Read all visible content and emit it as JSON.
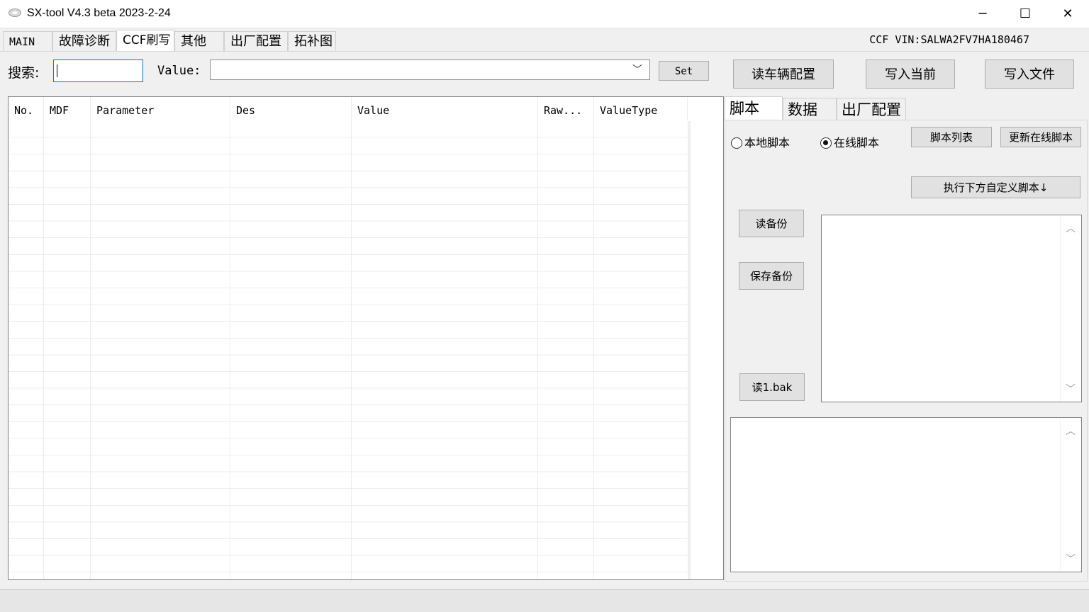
{
  "window": {
    "title": "SX-tool V4.3 beta 2023-2-24",
    "minimize_glyph": "─",
    "maximize_glyph": "☐",
    "close_glyph": "✕"
  },
  "tabs": [
    {
      "label": "MAIN"
    },
    {
      "label": "故障诊断"
    },
    {
      "label": "CCF刷写"
    },
    {
      "label": "其他"
    },
    {
      "label": "出厂配置"
    },
    {
      "label": "拓补图"
    }
  ],
  "active_tab": "CCF刷写",
  "vin_label": "CCF VIN:SALWA2FV7HA180467",
  "toolbar": {
    "search_label": "搜索:",
    "search_value": "",
    "value_label": "Value:",
    "value_selected": "",
    "set_label": "Set",
    "read_vehicle_label": "读车辆配置",
    "write_current_label": "写入当前",
    "write_file_label": "写入文件"
  },
  "grid": {
    "columns": [
      "No.",
      "MDF",
      "Parameter",
      "Des",
      "Value",
      "Raw...",
      "ValueType"
    ],
    "rows": []
  },
  "right_tabs": [
    {
      "label": "脚本"
    },
    {
      "label": "数据"
    },
    {
      "label": "出厂配置"
    }
  ],
  "script_panel": {
    "local_script_label": "本地脚本",
    "online_script_label": "在线脚本",
    "selected": "在线脚本",
    "script_list_label": "脚本列表",
    "update_online_label": "更新在线脚本",
    "run_custom_label": "执行下方自定义脚本↓",
    "read_backup_label": "读备份",
    "save_backup_label": "保存备份",
    "read_bak_label": "读1.bak",
    "script_text": "",
    "log_text": ""
  },
  "icons": {
    "app": "app-logo-icon",
    "dropdown": "chevron-down-icon",
    "scroll_up": "chevron-up-icon",
    "scroll_down": "chevron-down-icon"
  }
}
